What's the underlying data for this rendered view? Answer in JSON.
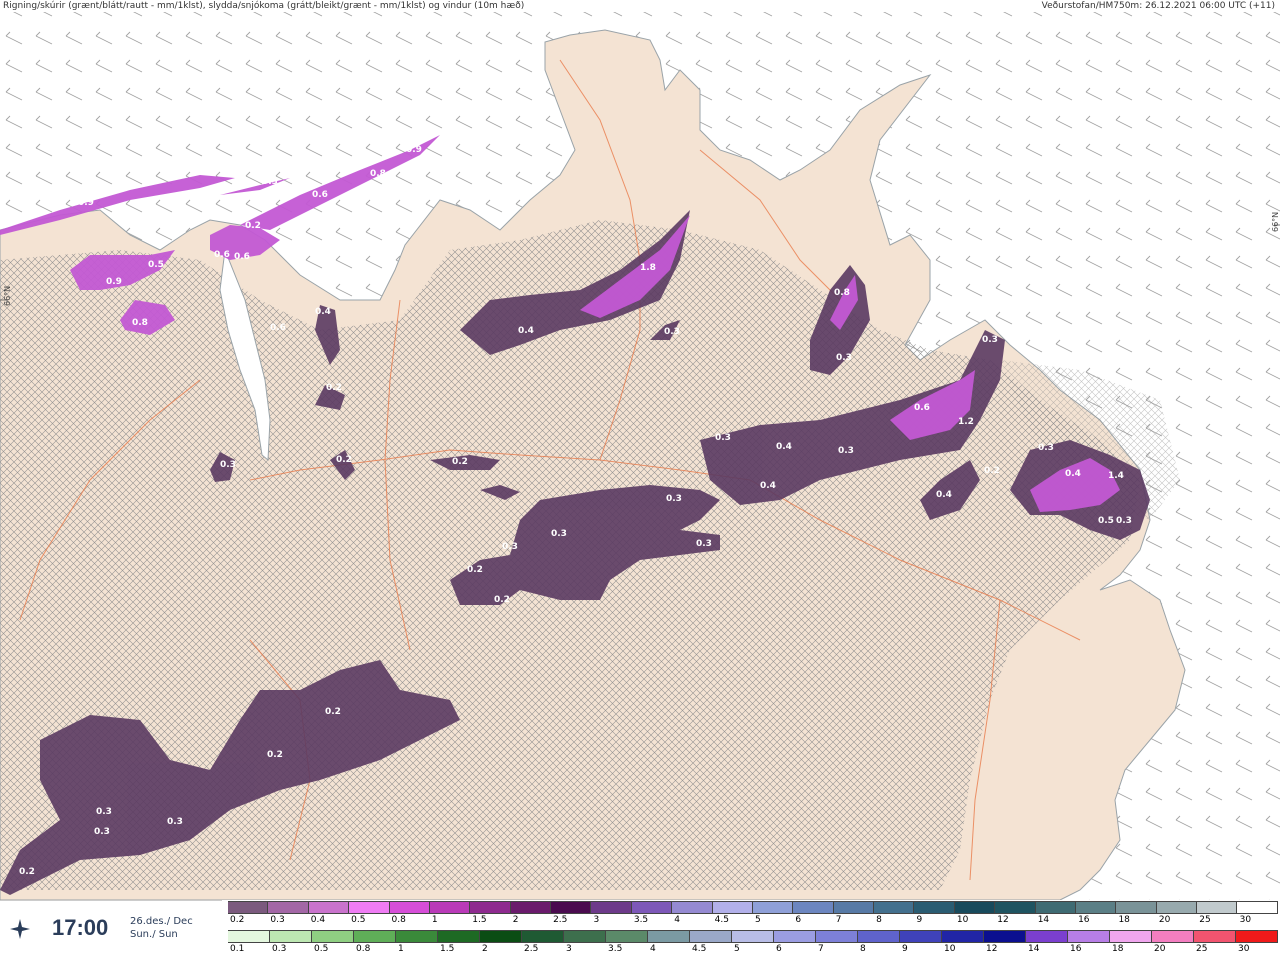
{
  "header": {
    "title": "Rigning/skúrir (grænt/blátt/rautt - mm/1klst), slydda/snjókoma (grátt/bleikt/grænt - mm/1klst) og vindur (10m hæð)",
    "source": "Veðurstofan/HM750m: 26.12.2021 06:00 UTC (+11)"
  },
  "map": {
    "lat_labels": [
      "66°N",
      "66°N"
    ],
    "values": [
      "0.9",
      "0.3",
      "0.6",
      "0.8",
      "0.9",
      "0.5",
      "0.8",
      "0.6",
      "0.6",
      "0.2",
      "0.9",
      "0.6",
      "0.4",
      "0.4",
      "1.8",
      "0.3",
      "0.8",
      "0.3",
      "0.3",
      "0.2",
      "0.3",
      "0.2",
      "0.3",
      "0.4",
      "0.4",
      "0.3",
      "0.6",
      "1.2",
      "0.3",
      "0.4",
      "0.2",
      "0.4",
      "1.4",
      "0.5",
      "0.3",
      "0.3",
      "0.3",
      "0.3",
      "0.3",
      "0.2",
      "0.2",
      "0.2",
      "0.2",
      "0.2",
      "0.3",
      "0.3",
      "0.3",
      "0.2"
    ],
    "colors": {
      "land": "#f4e3d3",
      "sea": "#ffffff",
      "road": "#e87a4a",
      "precip_dark": "#5b3a62",
      "precip_mid": "#c359d4",
      "precip_light": "#ef7cf4"
    }
  },
  "time": {
    "hour": "17:00",
    "date_line1": "26.des./ Dec",
    "date_line2": "Sun./ Sun"
  },
  "legend": {
    "snow_labels": [
      "0.2",
      "0.3",
      "0.4",
      "0.5",
      "0.8",
      "1",
      "1.5",
      "2",
      "2.5",
      "3",
      "3.5",
      "4",
      "4.5",
      "5",
      "6",
      "7",
      "8",
      "9",
      "10",
      "12",
      "14",
      "16",
      "18",
      "20",
      "25",
      "30"
    ],
    "snow_colors": [
      "#7b5a7e",
      "#a367a6",
      "#c973cc",
      "#ef7cf4",
      "#d64ed8",
      "#b93ab8",
      "#8e2a8f",
      "#6a1b6c",
      "#4a0b4f",
      "#6d3a8a",
      "#7d58b8",
      "#958ad2",
      "#b2b0ea",
      "#8fa0d8",
      "#6c86c0",
      "#577aa6",
      "#43708e",
      "#2a5c72",
      "#184a5c",
      "#1f5461",
      "#3f6b73",
      "#5b7f86",
      "#7a9398",
      "#98aaae",
      "#c1cacd",
      "#ffffff"
    ],
    "rain_labels": [
      "0.1",
      "0.3",
      "0.5",
      "0.8",
      "1",
      "1.5",
      "2",
      "2.5",
      "3",
      "3.5",
      "4",
      "4.5",
      "5",
      "6",
      "7",
      "8",
      "9",
      "10",
      "12",
      "14",
      "16",
      "18",
      "20",
      "25",
      "30"
    ],
    "rain_colors": [
      "#e4f7df",
      "#bde7b2",
      "#8fcf82",
      "#5fae58",
      "#3a8a3a",
      "#1e6a24",
      "#0b4d14",
      "#1f5a33",
      "#3d6f4d",
      "#5b8a69",
      "#7b9aa3",
      "#9aa8c8",
      "#b8bde6",
      "#9b9de2",
      "#7d80d8",
      "#5f63cc",
      "#3f42ba",
      "#2125a6",
      "#0b0f8f",
      "#7b3fcf",
      "#b77ee6",
      "#f0a6ee",
      "#f37ec0",
      "#f2546f",
      "#f01a1a"
    ]
  }
}
